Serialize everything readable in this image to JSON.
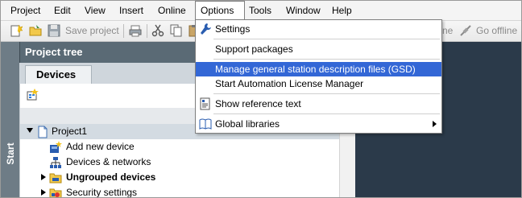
{
  "menubar": {
    "items": [
      "Project",
      "Edit",
      "View",
      "Insert",
      "Online",
      "Options",
      "Tools",
      "Window",
      "Help"
    ],
    "open_item": "Options"
  },
  "toolbar": {
    "save_project_label": "Save project",
    "trailing_label_partial": "ne",
    "go_offline_label": "Go offline"
  },
  "options_menu": {
    "settings": "Settings",
    "support_packages": "Support packages",
    "manage_gsd": "Manage general station description files (GSD)",
    "start_alm": "Start Automation License Manager",
    "show_reference_text": "Show reference text",
    "global_libraries": "Global libraries"
  },
  "project_tree": {
    "title": "Project tree",
    "tab_devices": "Devices",
    "rows": {
      "project": "Project1",
      "add_new_device": "Add new device",
      "devices_networks": "Devices & networks",
      "ungrouped_devices": "Ungrouped devices",
      "security_settings": "Security settings"
    }
  },
  "start_strip": {
    "label": "Start"
  },
  "colors": {
    "menu_highlight": "#3367d6",
    "tree_header": "#5a6a75",
    "start_strip": "#6e7c86",
    "work_area": "#2b3a4a"
  }
}
